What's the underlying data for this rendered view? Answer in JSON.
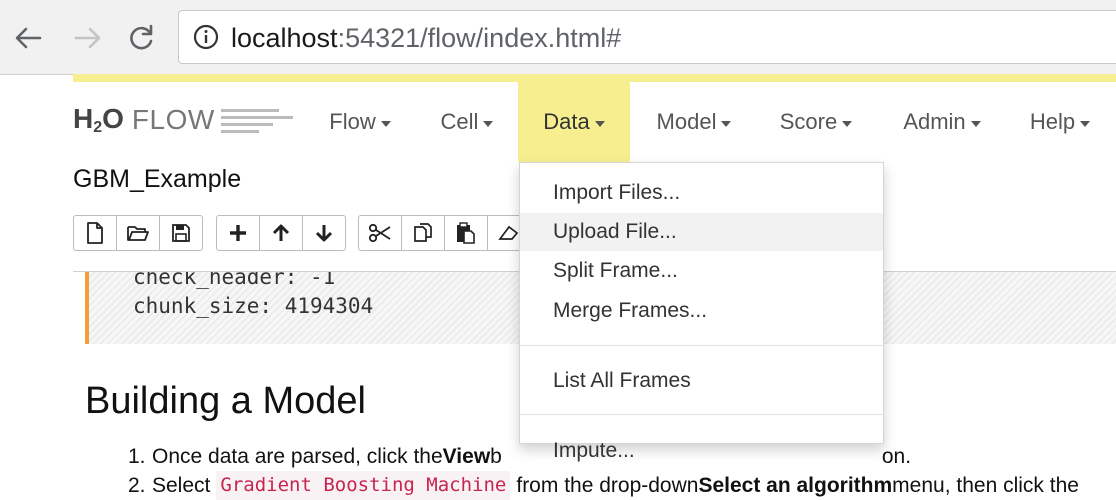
{
  "browser": {
    "url_host": "localhost",
    "url_path": ":54321/flow/index.html#"
  },
  "app": {
    "logo_h": "H",
    "logo_sub": "2",
    "logo_o": "O",
    "logo_flow": "FLOW",
    "menu": [
      {
        "label": "Flow"
      },
      {
        "label": "Cell"
      },
      {
        "label": "Data"
      },
      {
        "label": "Model"
      },
      {
        "label": "Score"
      },
      {
        "label": "Admin"
      },
      {
        "label": "Help"
      }
    ],
    "active_menu": "Data",
    "accent_color": "#f7ef8f",
    "cell_accent_color": "#f39c3c"
  },
  "flow": {
    "title": "GBM_Example"
  },
  "toolbar": {
    "groups": [
      [
        "new-file-icon",
        "open-folder-icon",
        "save-icon"
      ],
      [
        "plus-icon",
        "arrow-up-icon",
        "arrow-down-icon"
      ],
      [
        "scissors-icon",
        "copy-icon",
        "paste-icon",
        "eraser-icon"
      ]
    ]
  },
  "cell_output": {
    "line1": "check_header: -1",
    "line2": "chunk_size: 4194304"
  },
  "content": {
    "heading": "Building a Model",
    "step1_num": "1.",
    "step1_a": "Once data are parsed, click the ",
    "step1_b": "View",
    "step1_c": " b",
    "step1_d": "on.",
    "step2_num": "2.",
    "step2_a": "Select",
    "step2_code": "Gradient Boosting Machine",
    "step2_b": "from the drop-down ",
    "step2_c": "Select an algorithm",
    "step2_d": " menu, then click the"
  },
  "dropdown": {
    "items": [
      {
        "label": "Import Files..."
      },
      {
        "label": "Upload File..."
      },
      {
        "label": "Split Frame..."
      },
      {
        "label": "Merge Frames..."
      },
      {
        "label": "List All Frames"
      },
      {
        "label": "Impute..."
      }
    ],
    "hovered": "Upload File..."
  }
}
